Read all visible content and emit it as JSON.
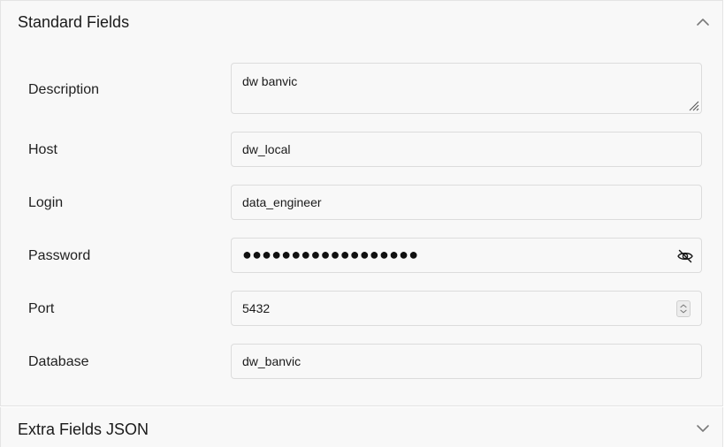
{
  "standard_fields": {
    "title": "Standard Fields",
    "description": {
      "label": "Description",
      "value": "dw banvic"
    },
    "host": {
      "label": "Host",
      "value": "dw_local"
    },
    "login": {
      "label": "Login",
      "value": "data_engineer"
    },
    "password": {
      "label": "Password",
      "value": "●●●●●●●●●●●●●●●●●●"
    },
    "port": {
      "label": "Port",
      "value": "5432"
    },
    "database": {
      "label": "Database",
      "value": "dw_banvic"
    },
    "icons": {
      "collapse": "chevron-up-icon",
      "visibility": "eye-off-icon",
      "stepper": "spin-stepper-icon",
      "resize": "resize-grip-icon"
    }
  },
  "extra_fields": {
    "title": "Extra Fields JSON",
    "icon": "chevron-down-icon"
  }
}
